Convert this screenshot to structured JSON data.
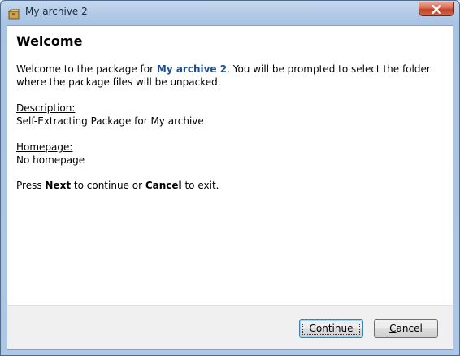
{
  "window": {
    "title": "My archive 2"
  },
  "content": {
    "heading": "Welcome",
    "intro_prefix": "Welcome to the package for ",
    "archive_name": "My archive 2",
    "intro_suffix": ". You will be prompted to select the folder where the package files will be unpacked.",
    "description_label": "Description:",
    "description_value": "Self-Extracting Package for My archive",
    "homepage_label": "Homepage:",
    "homepage_value": "No homepage",
    "press_prefix": "Press ",
    "press_next": "Next",
    "press_middle": " to continue or ",
    "press_cancel": "Cancel",
    "press_suffix": " to exit."
  },
  "buttons": {
    "continue_label": "Continue",
    "cancel_accel": "C",
    "cancel_rest": "ancel"
  },
  "colors": {
    "archive_name": "#1f4e8c",
    "title_bar": "#b6cde8",
    "close_button": "#c2412a"
  },
  "icons": {
    "app": "package-icon",
    "close": "close-icon"
  }
}
